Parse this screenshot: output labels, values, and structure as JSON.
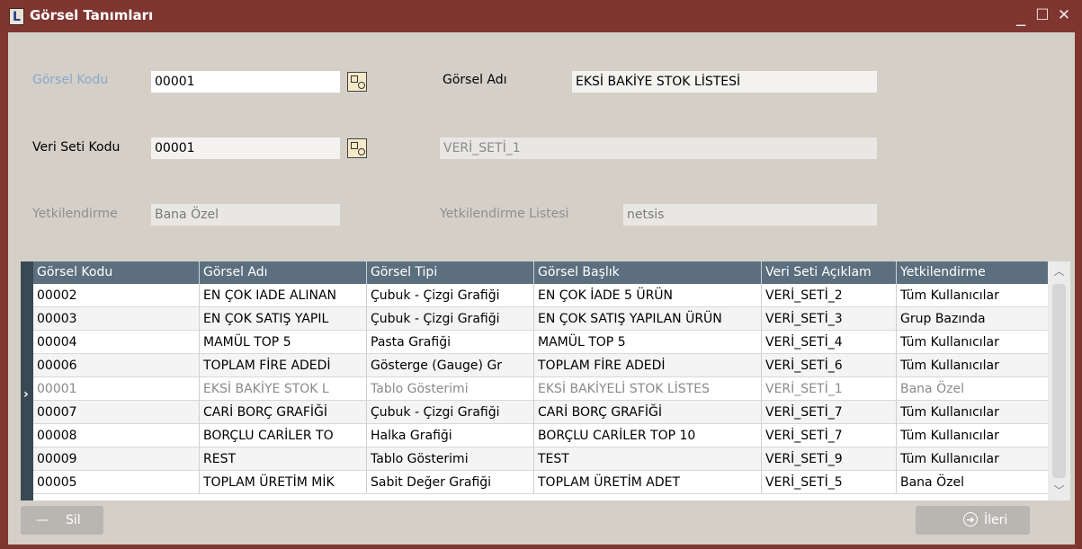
{
  "window": {
    "title": "Görsel Tanımları",
    "app_icon_letter": "L",
    "minimize": "_",
    "maximize": "☐",
    "close": "✕"
  },
  "form": {
    "gorsel_kodu": {
      "label": "Görsel Kodu",
      "value": "00001"
    },
    "gorsel_adi": {
      "label": "Görsel Adı",
      "value": "EKSİ BAKİYE STOK LİSTESİ"
    },
    "veri_seti_kodu": {
      "label": "Veri Seti Kodu",
      "value": "00001"
    },
    "veri_seti_adi": {
      "value": "VERİ_SETİ_1"
    },
    "yetkilendirme": {
      "label": "Yetkilendirme",
      "value": "Bana Özel"
    },
    "yetkilendirme_listesi": {
      "label": "Yetkilendirme Listesi",
      "value": "netsis"
    }
  },
  "grid": {
    "columns": [
      "Görsel Kodu",
      "Görsel Adı",
      "Görsel Tipi",
      "Görsel Başlık",
      "Veri Seti Açıklam",
      "Yetkilendirme"
    ],
    "rows": [
      [
        "00002",
        "EN ÇOK IADE ALINAN",
        "Çubuk - Çizgi Grafiği",
        "EN ÇOK İADE 5 ÜRÜN",
        "VERİ_SETİ_2",
        "Tüm Kullanıcılar"
      ],
      [
        "00003",
        "EN ÇOK SATIŞ YAPIL",
        "Çubuk - Çizgi Grafiği",
        "EN ÇOK SATIŞ YAPILAN ÜRÜN",
        "VERİ_SETİ_3",
        "Grup Bazında"
      ],
      [
        "00004",
        "MAMÜL TOP 5",
        "Pasta Grafiği",
        "MAMÜL TOP 5",
        "VERİ_SETİ_4",
        "Tüm Kullanıcılar"
      ],
      [
        "00006",
        "TOPLAM FİRE ADEDİ",
        "Gösterge (Gauge) Gr",
        "TOPLAM FİRE ADEDİ",
        "VERİ_SETİ_6",
        "Tüm Kullanıcılar"
      ],
      [
        "00001",
        "EKSİ BAKİYE STOK L",
        "Tablo Gösterimi",
        "EKSİ BAKİYELİ STOK LİSTES",
        "VERİ_SETİ_1",
        "Bana Özel"
      ],
      [
        "00007",
        "CARİ BORÇ GRAFİĞİ",
        "Çubuk - Çizgi Grafiği",
        "CARİ BORÇ GRAFİĞİ",
        "VERİ_SETİ_7",
        "Tüm Kullanıcılar"
      ],
      [
        "00008",
        "BORÇLU CARİLER TO",
        "Halka Grafiği",
        "BORÇLU CARİLER TOP 10",
        "VERİ_SETİ_7",
        "Tüm Kullanıcılar"
      ],
      [
        "00009",
        "REST",
        "Tablo Gösterimi",
        "TEST",
        "VERİ_SETİ_9",
        "Tüm Kullanıcılar"
      ],
      [
        "00005",
        "TOPLAM ÜRETİM MİK",
        "Sabit Değer Grafiği",
        "TOPLAM ÜRETİM ADET",
        "VERİ_SETİ_5",
        "Bana Özel"
      ]
    ],
    "selected_index": 4,
    "selected_marker": "›"
  },
  "buttons": {
    "sil": {
      "label": "Sil",
      "icon": "minus-icon"
    },
    "ileri": {
      "label": "İleri",
      "icon": "arrow-right-circle-icon"
    }
  },
  "colors": {
    "titlebar": "#7f3630",
    "grid_header": "#5b6f7e",
    "accent_label": "#8aa8cc"
  }
}
